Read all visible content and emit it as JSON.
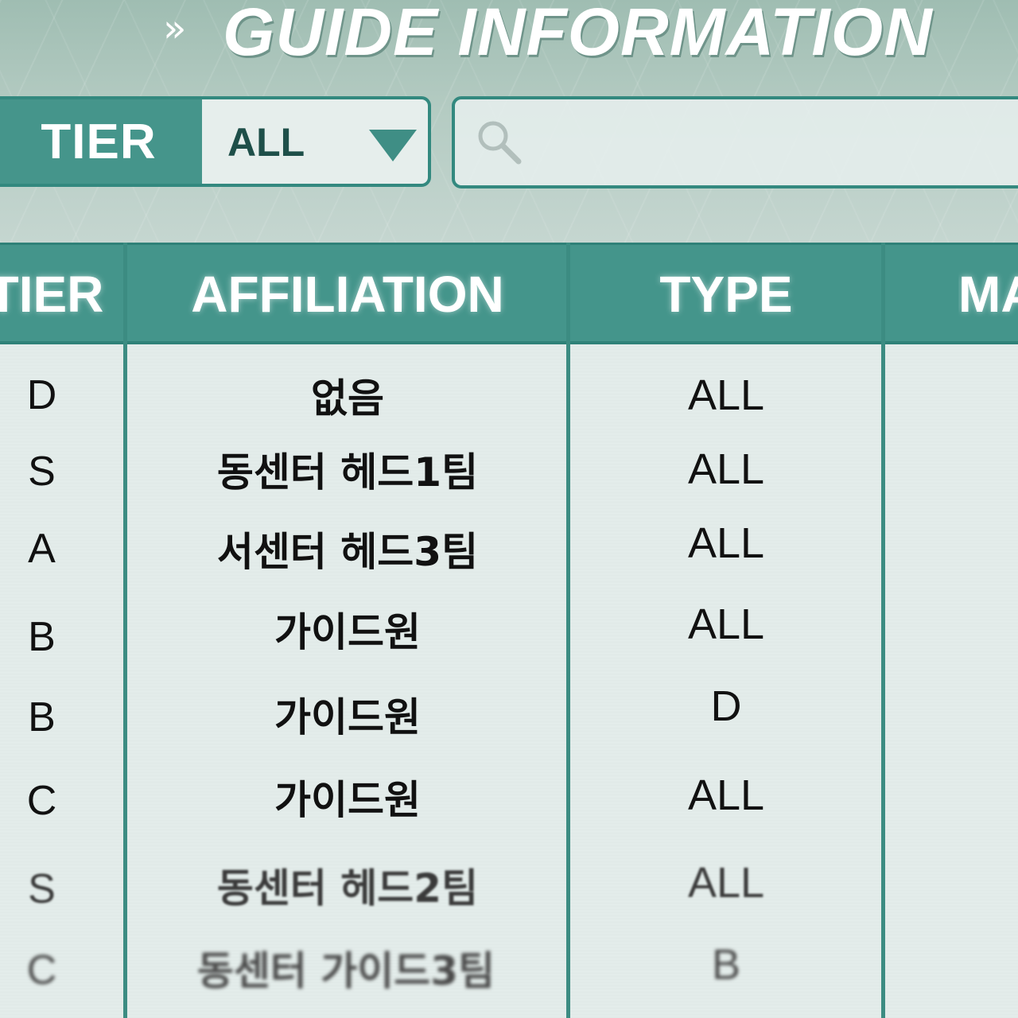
{
  "header": {
    "title": "GUIDE INFORMATION",
    "chevrons": "»"
  },
  "filter": {
    "label": "TIER",
    "selected_value": "ALL"
  },
  "search": {
    "value": ""
  },
  "table": {
    "columns": [
      "TIER",
      "AFFILIATION",
      "TYPE",
      "MA"
    ],
    "rows": [
      {
        "tier": "D",
        "affiliation": "없음",
        "type": "ALL"
      },
      {
        "tier": "S",
        "affiliation": "동센터 헤드1팀",
        "type": "ALL"
      },
      {
        "tier": "A",
        "affiliation": "서센터 헤드3팀",
        "type": "ALL"
      },
      {
        "tier": "B",
        "affiliation": "가이드원",
        "type": "ALL"
      },
      {
        "tier": "B",
        "affiliation": "가이드원",
        "type": "D"
      },
      {
        "tier": "C",
        "affiliation": "가이드원",
        "type": "ALL"
      },
      {
        "tier": "S",
        "affiliation": "동센터 헤드2팀",
        "type": "ALL"
      },
      {
        "tier": "C",
        "affiliation": "동센터 가이드3팀",
        "type": "B"
      }
    ]
  },
  "colors": {
    "header_teal": "#44958b",
    "border_teal": "#2f8178",
    "background": "#e3ecea"
  }
}
